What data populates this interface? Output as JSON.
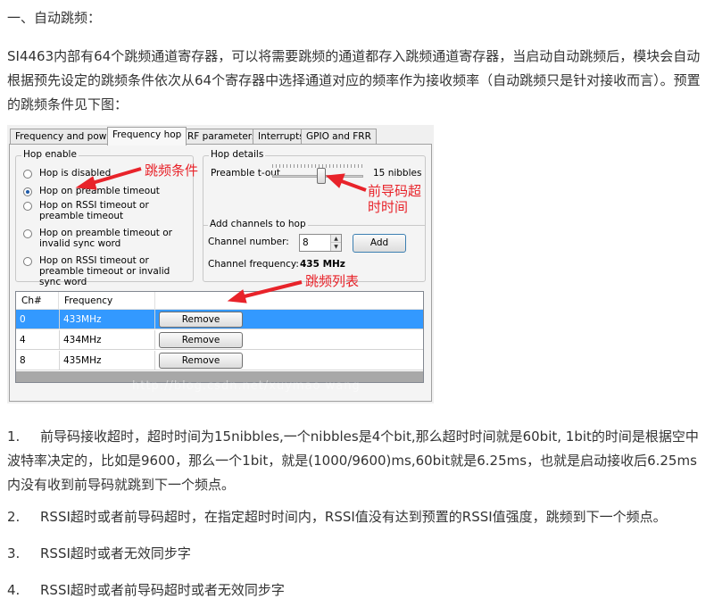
{
  "heading": "一、自动跳频：",
  "intro": "SI4463内部有64个跳频通道寄存器，可以将需要跳频的通道都存入跳频通道寄存器，当启动自动跳频后，模块会自动根据预先设定的跳频条件依次从64个寄存器中选择通道对应的频率作为接收频率（自动跳频只是针对接收而言）。预置的跳频条件见下图：",
  "screenshot": {
    "tabs": [
      "Frequency and power",
      "Frequency hop",
      "RF parameters",
      "Interrupts",
      "GPIO and FRR"
    ],
    "active_tab": "Frequency hop",
    "hop_enable": {
      "title": "Hop enable",
      "options": [
        "Hop is disabled",
        "Hop on preamble timeout",
        "Hop on RSSI timeout or preamble timeout",
        "Hop on preamble timeout or invalid sync word",
        "Hop on RSSI timeout or preamble timeout or invalid sync word"
      ],
      "selected_index": 1
    },
    "hop_details": {
      "title": "Hop details",
      "preamble_label": "Preamble t-out",
      "preamble_value": "15 nibbles",
      "slider_fraction": 0.54
    },
    "add_channels": {
      "title": "Add channels to hop",
      "channel_number_label": "Channel number:",
      "channel_number_value": "8",
      "add_button": "Add",
      "channel_frequency_label": "Channel frequency:",
      "channel_frequency_value": "435 MHz"
    },
    "list": {
      "headers": [
        "Ch#",
        "Frequency"
      ],
      "rows": [
        {
          "ch": "0",
          "freq": "433MHz",
          "action": "Remove",
          "selected": true
        },
        {
          "ch": "4",
          "freq": "434MHz",
          "action": "Remove",
          "selected": false
        },
        {
          "ch": "8",
          "freq": "435MHz",
          "action": "Remove",
          "selected": false
        }
      ]
    },
    "watermark": "http://blog.csdn.net/xuymao wang",
    "annotations": {
      "hop_condition": "跳频条件",
      "preamble_timeout_line1": "前导码超",
      "preamble_timeout_line2": "时时间",
      "hop_list": "跳频列表"
    },
    "annotation_color": "#e8232a"
  },
  "items": [
    {
      "num": "1.",
      "text": "前导码接收超时，超时时间为15nibbles,一个nibbles是4个bit,那么超时时间就是60bit, 1bit的时间是根据空中波特率决定的，比如是9600，那么一个1bit，就是(1000/9600)ms,60bit就是6.25ms，也就是启动接收后6.25ms内没有收到前导码就跳到下一个频点。"
    },
    {
      "num": "2.",
      "text": "RSSI超时或者前导码超时，在指定超时时间内，RSSI值没有达到预置的RSSI值强度，跳频到下一个频点。"
    },
    {
      "num": "3.",
      "text": "RSSI超时或者无效同步字"
    },
    {
      "num": "4.",
      "text": "RSSI超时或者前导码超时或者无效同步字"
    }
  ]
}
